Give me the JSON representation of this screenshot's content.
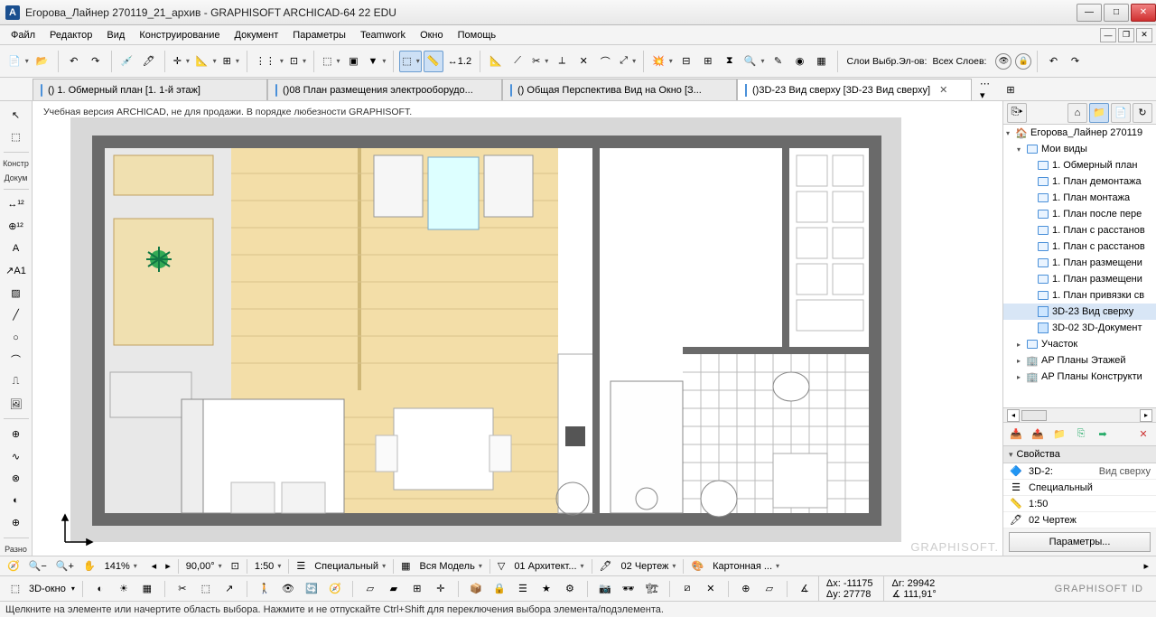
{
  "titlebar": {
    "app_icon": "A",
    "title": "Егорова_Лайнер 270119_21_архив - GRAPHISOFT ARCHICAD-64 22 EDU"
  },
  "menu": [
    "Файл",
    "Редактор",
    "Вид",
    "Конструирование",
    "Документ",
    "Параметры",
    "Teamwork",
    "Окно",
    "Помощь"
  ],
  "toolbar_right": {
    "layer_combo_label": "Слои Выбр.Эл-ов:",
    "all_layers_label": "Всех Слоев:"
  },
  "tabs": [
    {
      "icon": "folder",
      "label": "() 1. Обмерный план [1. 1-й этаж]",
      "active": false
    },
    {
      "icon": "doc",
      "label": "()08 План размещения электрооборудо...",
      "active": false
    },
    {
      "icon": "doc",
      "label": "() Общая Перспектива Вид на Окно [З...",
      "active": false
    },
    {
      "icon": "3d",
      "label": "()3D-23 Вид сверху [3D-23 Вид сверху]",
      "active": true
    }
  ],
  "left_labels": {
    "konstr": "Констр",
    "dokum": "Докум",
    "razno": "Разно"
  },
  "viewport": {
    "watermark": "Учебная версия ARCHICAD, не для продажи. В порядке любезности GRAPHISOFT.",
    "brand": "GRAPHISOFT."
  },
  "view_bar": {
    "zoom": "141%",
    "angle": "90,00°",
    "scale": "1:50",
    "layer_combo": "Специальный",
    "model_view": "Вся Модель",
    "reno": "01 Архитект...",
    "pen_set": "02 Чертеж",
    "graphic_override": "Картонная ..."
  },
  "nav_tree": {
    "root": "Егорова_Лайнер 270119",
    "my_views": "Мои виды",
    "views": [
      "1. Обмерный план",
      "1. План демонтажа",
      "1. План монтажа",
      "1. План после пере",
      "1. План с расстанов",
      "1. План с расстанов",
      "1. План размещени",
      "1. План размещени",
      "1. План привязки св"
    ],
    "view_3d_a": "3D-23 Вид сверху",
    "view_3d_b": "3D-02 3D-Документ",
    "other_folders": [
      "Участок",
      "AP Планы Этажей",
      "AP Планы Конструкти"
    ]
  },
  "nav_actions": {},
  "properties": {
    "header": "Свойства",
    "rows": [
      {
        "icon": "3d",
        "k": "3D-2:",
        "v": "Вид сверху"
      },
      {
        "icon": "layers",
        "k": "Специальный"
      },
      {
        "icon": "scale",
        "k": "1:50"
      },
      {
        "icon": "pen",
        "k": "02 Чертеж"
      }
    ],
    "button": "Параметры..."
  },
  "coords_bar": {
    "window_label": "3D-окно",
    "dx": "Δx: -11175",
    "dy": "Δy: 27778",
    "dr": "Δr: 29942",
    "da": "∡ 111,91°",
    "gs_id": "GRAPHISOFT ID"
  },
  "statusbar": "Щелкните на элементе или начертите область выбора. Нажмите и не отпускайте Ctrl+Shift для переключения выбора элемента/подэлемента."
}
